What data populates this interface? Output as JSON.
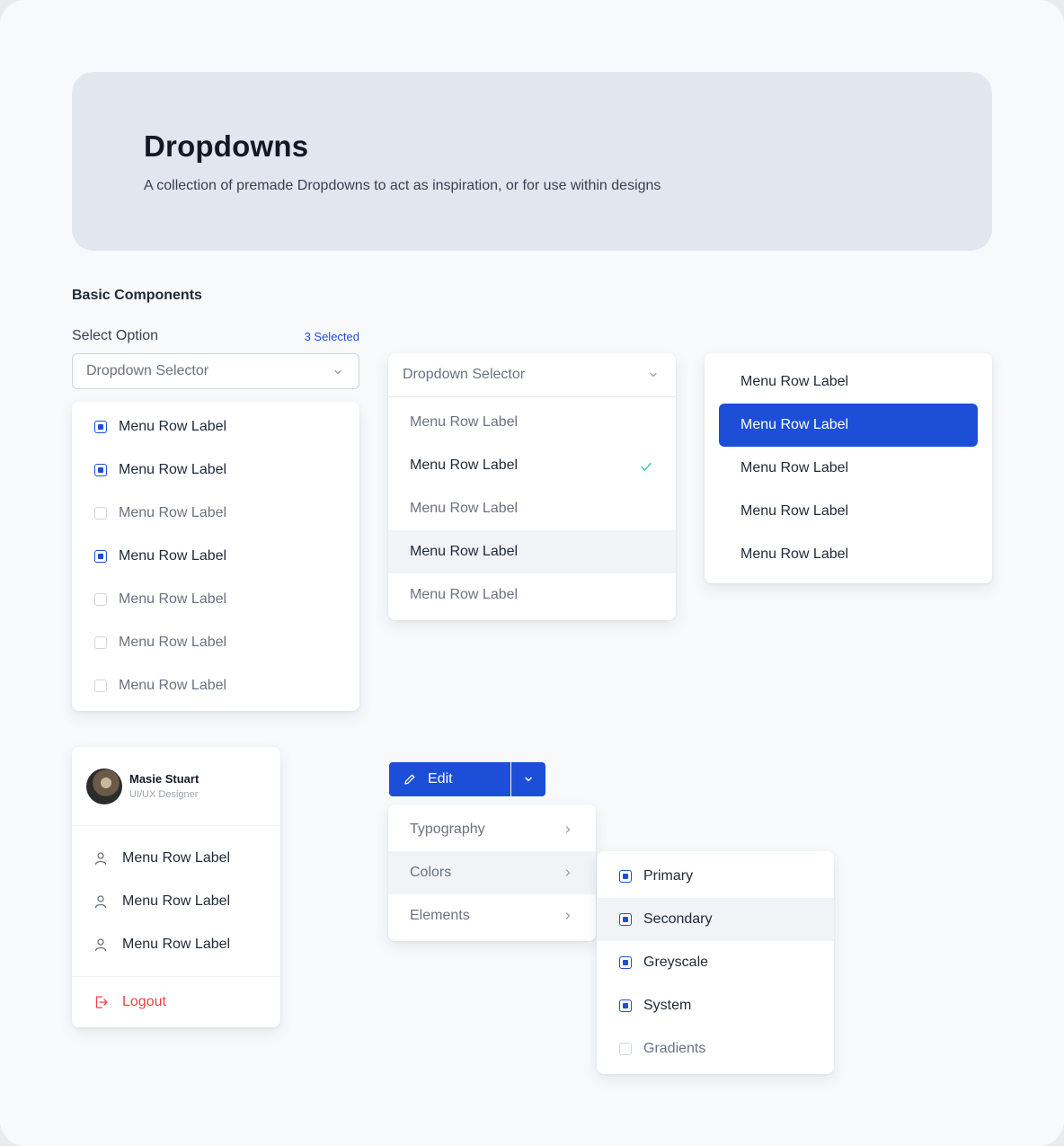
{
  "hero": {
    "title": "Dropdowns",
    "subtitle": "A collection of premade Dropdowns to act as inspiration, or for use within designs"
  },
  "section": {
    "title": "Basic Components"
  },
  "select_field": {
    "label": "Select Option",
    "count": "3 Selected",
    "placeholder": "Dropdown Selector"
  },
  "checkbox_list": {
    "items": [
      {
        "label": "Menu Row Label",
        "checked": true
      },
      {
        "label": "Menu Row Label",
        "checked": true
      },
      {
        "label": "Menu Row Label",
        "checked": false
      },
      {
        "label": "Menu Row Label",
        "checked": true
      },
      {
        "label": "Menu Row Label",
        "checked": false
      },
      {
        "label": "Menu Row Label",
        "checked": false
      },
      {
        "label": "Menu Row Label",
        "checked": false
      }
    ]
  },
  "single_select": {
    "placeholder": "Dropdown Selector",
    "items": [
      {
        "label": "Menu Row Label",
        "state": "default"
      },
      {
        "label": "Menu Row Label",
        "state": "selected"
      },
      {
        "label": "Menu Row Label",
        "state": "default"
      },
      {
        "label": "Menu Row Label",
        "state": "hover"
      },
      {
        "label": "Menu Row Label",
        "state": "default"
      }
    ]
  },
  "simple_menu": {
    "items": [
      {
        "label": "Menu Row Label",
        "active": false
      },
      {
        "label": "Menu Row Label",
        "active": true
      },
      {
        "label": "Menu Row Label",
        "active": false
      },
      {
        "label": "Menu Row Label",
        "active": false
      },
      {
        "label": "Menu Row Label",
        "active": false
      }
    ]
  },
  "user_menu": {
    "name": "Masie Stuart",
    "role": "UI/UX Designer",
    "items": [
      {
        "label": "Menu Row Label",
        "icon": "user-icon"
      },
      {
        "label": "Menu Row Label",
        "icon": "user-icon"
      },
      {
        "label": "Menu Row Label",
        "icon": "user-icon"
      }
    ],
    "logout": "Logout"
  },
  "edit_menu": {
    "button_label": "Edit",
    "items": [
      {
        "label": "Typography",
        "hover": false
      },
      {
        "label": "Colors",
        "hover": true
      },
      {
        "label": "Elements",
        "hover": false
      }
    ],
    "submenu": [
      {
        "label": "Primary",
        "checked": true,
        "hover": false
      },
      {
        "label": "Secondary",
        "checked": true,
        "hover": true
      },
      {
        "label": "Greyscale",
        "checked": true,
        "hover": false
      },
      {
        "label": "System",
        "checked": true,
        "hover": false
      },
      {
        "label": "Gradients",
        "checked": false,
        "hover": false
      }
    ]
  },
  "colors": {
    "accent": "#1d4ed8",
    "check_green": "#34d399",
    "danger": "#ef4444",
    "hover_bg": "#f1f3f7"
  }
}
